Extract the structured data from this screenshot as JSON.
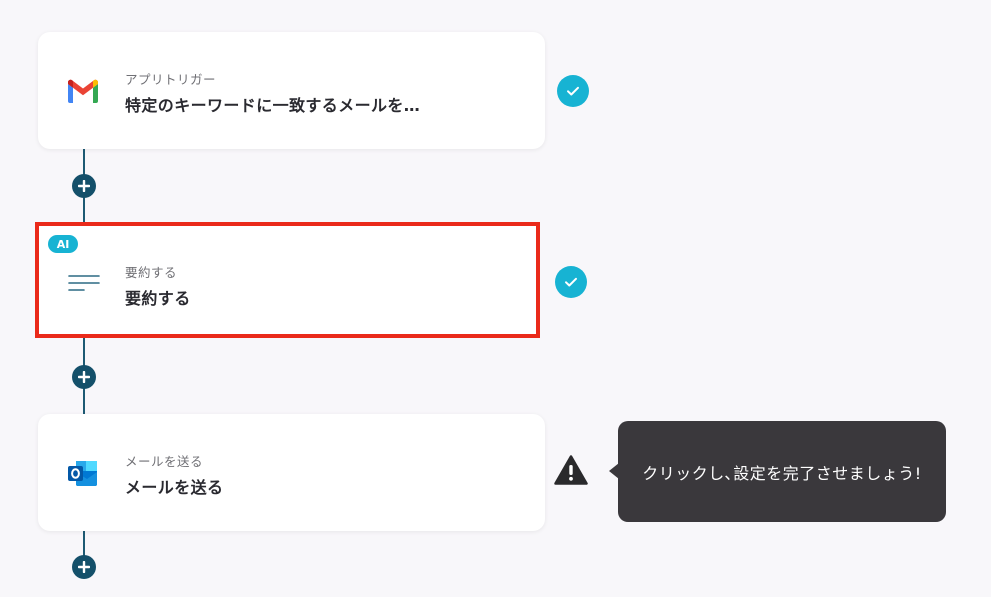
{
  "steps": [
    {
      "subtitle": "アプリトリガー",
      "title": "特定のキーワードに一致するメールを…",
      "icon": "gmail-icon",
      "status": "complete"
    },
    {
      "badge": "AI",
      "subtitle": "要約する",
      "title": "要約する",
      "icon": "summary-lines-icon",
      "status": "complete",
      "selected": true
    },
    {
      "subtitle": "メールを送る",
      "title": "メールを送る",
      "icon": "outlook-icon",
      "status": "warning"
    }
  ],
  "tooltip": {
    "text": "クリックし､設定を完了させましょう!"
  },
  "colors": {
    "accent": "#17b3d3",
    "connector": "#1d5a73",
    "highlight": "#ea2a1a",
    "tooltip_bg": "#3a383c"
  }
}
